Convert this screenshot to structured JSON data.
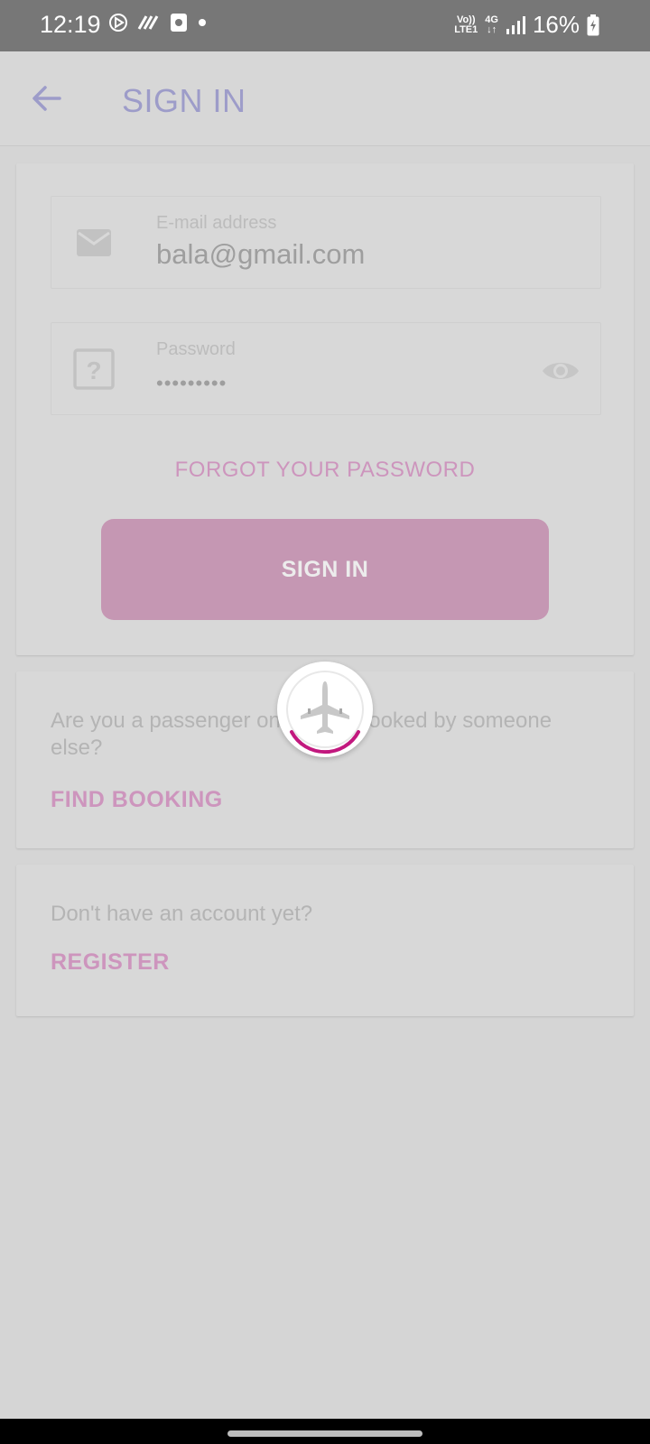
{
  "status_bar": {
    "time": "12:19",
    "network_top": "Vo))",
    "network_bottom": "LTE1",
    "network_type": "4G",
    "battery": "16%"
  },
  "app_bar": {
    "title": "SIGN IN"
  },
  "signin_form": {
    "email_label": "E-mail address",
    "email_value": "bala@gmail.com",
    "password_label": "Password",
    "password_value": "•••••••••",
    "forgot_link": "FORGOT YOUR PASSWORD",
    "signin_button": "SIGN IN"
  },
  "booking_card": {
    "text": "Are you a passenger on a flight booked by someone else?",
    "link": "FIND BOOKING"
  },
  "register_card": {
    "text": "Don't have an account yet?",
    "link": "REGISTER"
  },
  "colors": {
    "accent_pink": "#cd95bd",
    "title_purple": "#9d9cc9",
    "spinner": "#c2187e"
  },
  "icons": {
    "back": "arrow-left-icon",
    "email": "envelope-icon",
    "password": "question-box-icon",
    "visibility": "eye-icon",
    "loader": "airplane-icon"
  }
}
